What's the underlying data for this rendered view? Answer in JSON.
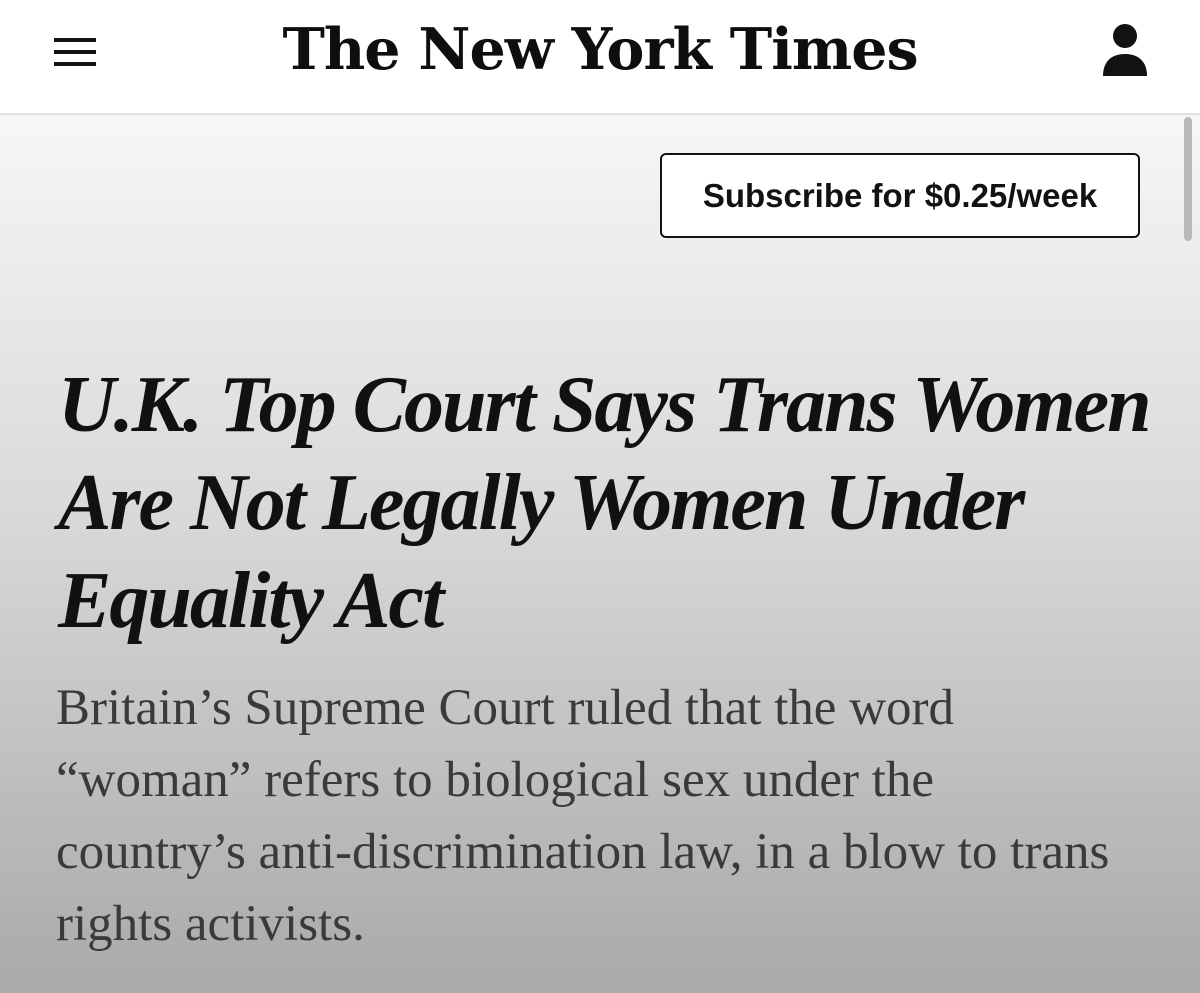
{
  "header": {
    "masthead": "The New York Times",
    "menu_icon": "hamburger-menu-icon",
    "account_icon": "person-icon"
  },
  "promo": {
    "subscribe_label": "Subscribe for $0.25/week"
  },
  "article": {
    "headline": "U.K. Top Court Says Trans Women Are Not Legally Women Under Equality Act",
    "summary": "Britain’s Supreme Court ruled that the word “woman” refers to biological sex under the country’s anti-discrimination law, in a blow to trans rights activists."
  },
  "colors": {
    "text": "#121212",
    "summary_text": "#3a3a3a",
    "header_bg": "#ffffff",
    "divider": "#e2e2e2"
  }
}
